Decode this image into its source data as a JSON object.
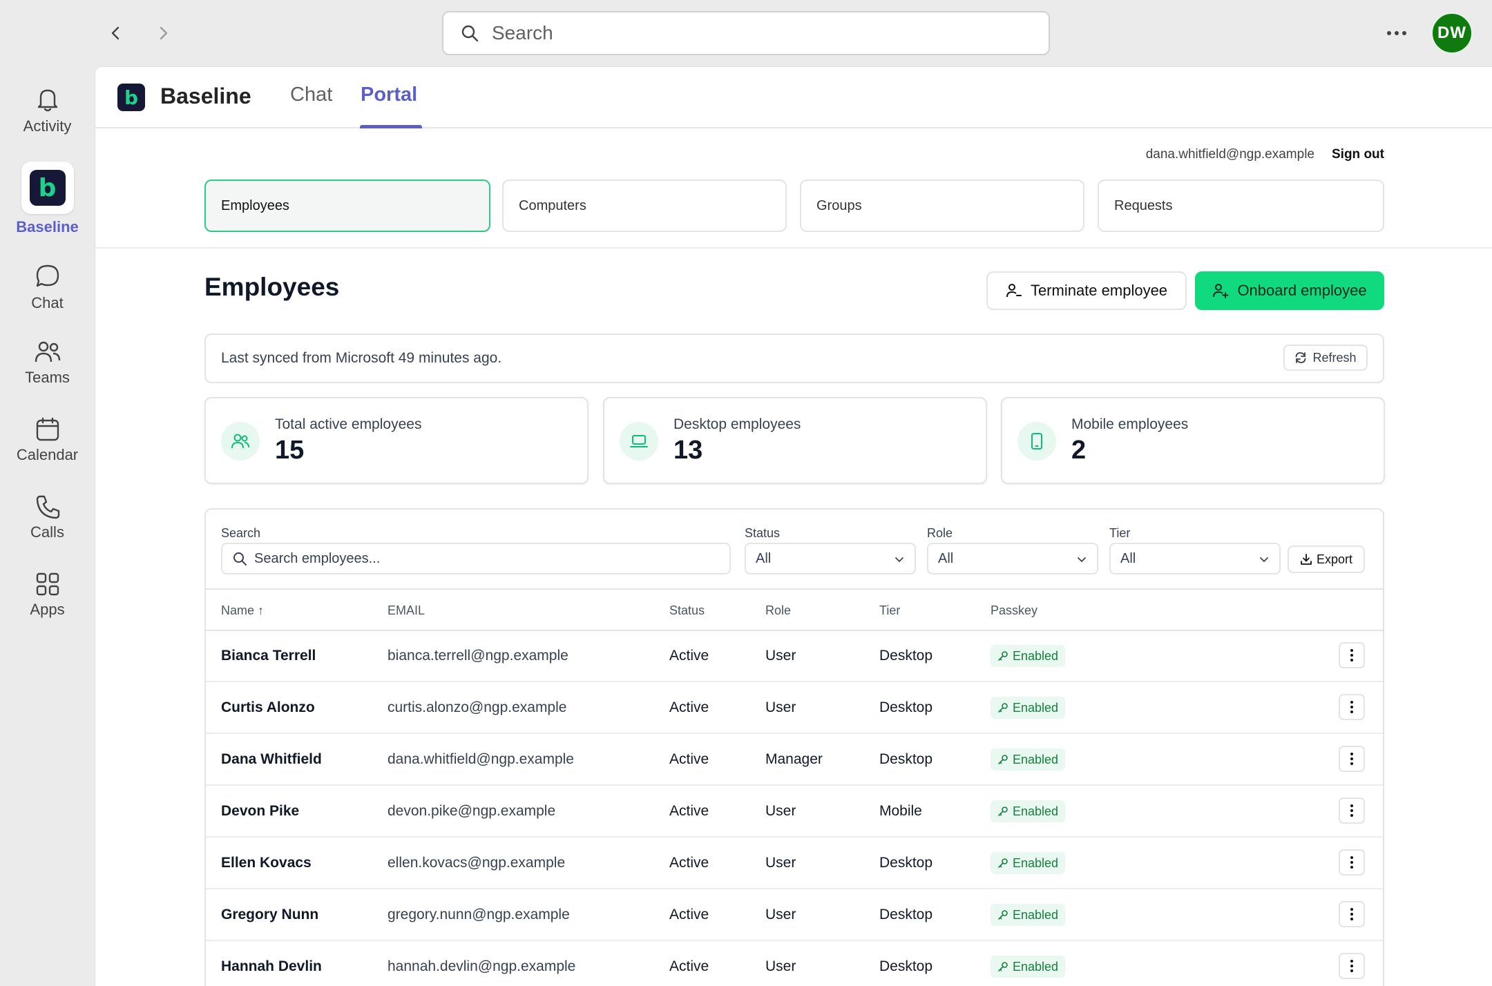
{
  "topbar": {
    "search_placeholder": "Search",
    "avatar_initials": "DW"
  },
  "rail": {
    "items": [
      {
        "label": "Activity",
        "icon": "bell-icon"
      },
      {
        "label": "Baseline",
        "icon": "baseline-app-icon",
        "active": true
      },
      {
        "label": "Chat",
        "icon": "chat-icon"
      },
      {
        "label": "Teams",
        "icon": "teams-icon"
      },
      {
        "label": "Calendar",
        "icon": "calendar-icon"
      },
      {
        "label": "Calls",
        "icon": "phone-icon"
      },
      {
        "label": "Apps",
        "icon": "apps-grid-icon"
      }
    ]
  },
  "app": {
    "logo_letter": "b",
    "name": "Baseline",
    "tabs": [
      {
        "label": "Chat",
        "active": false
      },
      {
        "label": "Portal",
        "active": true
      }
    ]
  },
  "portal": {
    "user_email": "dana.whitfield@ngp.example",
    "sign_out": "Sign out",
    "subnav": [
      {
        "label": "Employees",
        "active": true
      },
      {
        "label": "Computers",
        "active": false
      },
      {
        "label": "Groups",
        "active": false
      },
      {
        "label": "Requests",
        "active": false
      }
    ],
    "page_title": "Employees",
    "terminate_label": "Terminate employee",
    "onboard_label": "Onboard employee",
    "sync_text": "Last synced from Microsoft 49 minutes ago.",
    "refresh_label": "Refresh",
    "stats": [
      {
        "label": "Total active employees",
        "value": "15",
        "icon": "users-icon"
      },
      {
        "label": "Desktop employees",
        "value": "13",
        "icon": "laptop-icon"
      },
      {
        "label": "Mobile employees",
        "value": "2",
        "icon": "mobile-icon"
      }
    ],
    "filters": {
      "search_label": "Search",
      "search_placeholder": "Search employees...",
      "status_label": "Status",
      "status_value": "All",
      "role_label": "Role",
      "role_value": "All",
      "tier_label": "Tier",
      "tier_value": "All",
      "export_label": "Export"
    },
    "columns": [
      "Name ↑",
      "EMAIL",
      "Status",
      "Role",
      "Tier",
      "Passkey"
    ],
    "rows": [
      {
        "name": "Bianca Terrell",
        "email": "bianca.terrell@ngp.example",
        "status": "Active",
        "role": "User",
        "tier": "Desktop",
        "passkey": "Enabled"
      },
      {
        "name": "Curtis Alonzo",
        "email": "curtis.alonzo@ngp.example",
        "status": "Active",
        "role": "User",
        "tier": "Desktop",
        "passkey": "Enabled"
      },
      {
        "name": "Dana Whitfield",
        "email": "dana.whitfield@ngp.example",
        "status": "Active",
        "role": "Manager",
        "tier": "Desktop",
        "passkey": "Enabled"
      },
      {
        "name": "Devon Pike",
        "email": "devon.pike@ngp.example",
        "status": "Active",
        "role": "User",
        "tier": "Mobile",
        "passkey": "Enabled"
      },
      {
        "name": "Ellen Kovacs",
        "email": "ellen.kovacs@ngp.example",
        "status": "Active",
        "role": "User",
        "tier": "Desktop",
        "passkey": "Enabled"
      },
      {
        "name": "Gregory Nunn",
        "email": "gregory.nunn@ngp.example",
        "status": "Active",
        "role": "User",
        "tier": "Desktop",
        "passkey": "Enabled"
      },
      {
        "name": "Hannah Devlin",
        "email": "hannah.devlin@ngp.example",
        "status": "Active",
        "role": "User",
        "tier": "Desktop",
        "passkey": "Enabled"
      }
    ]
  },
  "colors": {
    "teams_accent": "#5b5fc7",
    "primary_green": "#10d97e",
    "badge_green": "#15803d",
    "avatar_green": "#0f7b0f",
    "logo_navy": "#171738"
  }
}
